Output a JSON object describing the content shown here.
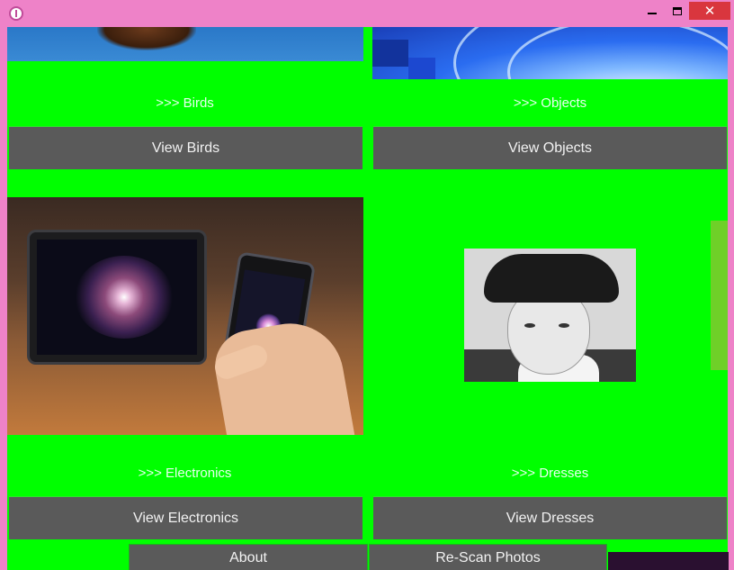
{
  "window": {
    "controls": {
      "minimize": "minimize-icon",
      "maximize": "maximize-icon",
      "close": "✕"
    }
  },
  "tiles": [
    {
      "caption": ">>> Birds",
      "button": "View Birds"
    },
    {
      "caption": ">>> Objects",
      "button": "View Objects"
    },
    {
      "caption": ">>> Electronics",
      "button": "View Electronics"
    },
    {
      "caption": ">>> Dresses",
      "button": "View Dresses"
    }
  ],
  "bottom": {
    "about": "About",
    "rescan": "Re-Scan Photos"
  },
  "colors": {
    "background": "#00ff00",
    "button": "#5a5a5a",
    "frame": "#ee82c8",
    "close": "#d9363e"
  }
}
